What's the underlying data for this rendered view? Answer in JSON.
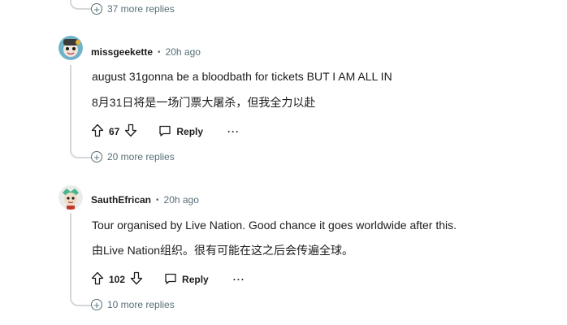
{
  "top_more": {
    "label": "37 more replies"
  },
  "comments": [
    {
      "username": "missgeekette",
      "time": "20h ago",
      "lines": [
        "august 31gonna be a bloodbath for tickets BUT I AM ALL IN",
        "8月31日将是一场门票大屠杀，但我全力以赴"
      ],
      "votes": "67",
      "reply_label": "Reply",
      "more_replies": "20 more replies"
    },
    {
      "username": "SauthEfrican",
      "time": "20h ago",
      "lines": [
        "Tour organised by Live Nation. Good chance it goes worldwide after this.",
        "由Live Nation组织。很有可能在这之后会传遍全球。"
      ],
      "votes": "102",
      "reply_label": "Reply",
      "more_replies": "10 more replies"
    }
  ],
  "icons": {
    "expand": "plus-circle-icon",
    "upvote": "arrow-up-icon",
    "downvote": "arrow-down-icon",
    "reply": "chat-bubble-icon",
    "overflow": "more-horizontal-icon"
  },
  "colors": {
    "meta": "#576f76",
    "line": "#d4d7d9"
  }
}
